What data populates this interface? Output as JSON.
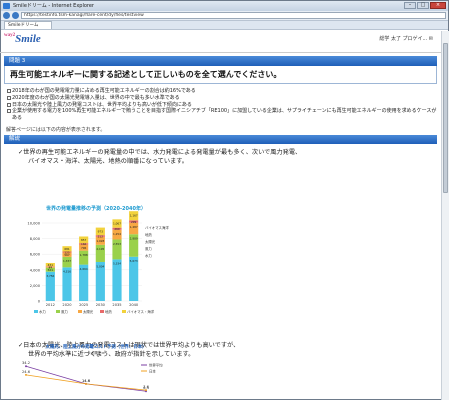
{
  "window": {
    "title": "Smileドリーム - Internet Explorer",
    "url": "https://testinfo.tsm-kanagi/flare-cent/dy/fles/testview",
    "tab": "Smileドリーム"
  },
  "header": {
    "logo": "Smile",
    "logo_prefix": "way2",
    "user": "総学 太了 プロゲイ... ✉"
  },
  "question": {
    "number_label": "問題 3",
    "title": "再生可能エネルギーに関する記述として正しいものを全て選んでください。",
    "choices": [
      "2018年のわが国の発電電力量に占める再生可能エネルギーの割合は約16%である",
      "2020年度のわが国の太陽光発電導入量は、世界の中で最も多い水準である",
      "日本の太陽光や陸上風力の発電コストは、世界平均よりも高いが低下傾向にある",
      "企業が使用する電力を100%再生可能エネルギーで賄うことを目指す国際イニシアチブ「RE100」に加盟している企業は、サプライチェーンにも再生可能エネルギーの使用を求めるケースがある"
    ],
    "answer_note": "解答ページには以下の内容が表示されます。"
  },
  "explanation": {
    "bar_label": "解説",
    "para1_line1": "✓世界の再生可能エネルギーの発電量の中では、水力発電による発電量が最も多く、次いで風力発電、",
    "para1_line2": "バイオマス・海洋、太陽光、地熱の順番になっています。",
    "para2_line1": "✓日本の太陽光、陸上風力の発電コストは現状では世界平均よりも高いですが、",
    "para2_line2": "世界の平均水準に近づくよう、政府が指針を示しています。"
  },
  "chart_data": [
    {
      "type": "bar",
      "title": "世界の発電量推移の予測（2020-2040年）",
      "categories": [
        "2012",
        "2020",
        "2025",
        "2030",
        "2035",
        "2040"
      ],
      "ylim": [
        0,
        10000
      ],
      "yticks": [
        "0",
        "2,000",
        "4,000",
        "6,000",
        "8,000",
        "10,000"
      ],
      "series": [
        {
          "name": "水力",
          "color": "#4cc6e8",
          "values": [
            3756,
            4316,
            4664,
            5004,
            5334,
            5673
          ]
        },
        {
          "name": "風力",
          "color": "#9ad14b",
          "values": [
            521,
            1337,
            1788,
            2195,
            2553,
            2889
          ]
        },
        {
          "name": "太陽光",
          "color": "#f7a844",
          "values": [
            97,
            567,
            796,
            1028,
            1254,
            1487
          ]
        },
        {
          "name": "地熱",
          "color": "#e86a6a",
          "values": [
            70,
            125,
            166,
            212,
            260,
            299
          ]
        },
        {
          "name": "バイオマス・海洋",
          "color": "#f2d23c",
          "values": [
            431,
            681,
            857,
            973,
            1067,
            1167
          ]
        }
      ],
      "legend": "bottom",
      "side_labels": [
        "バイオマス海洋",
        "地熱",
        "太陽光",
        "風力",
        "水力"
      ]
    },
    {
      "type": "line",
      "title": "太陽光、陸上風力の発電コスト予測（世界、日本）",
      "subtitle": "<太陽光>",
      "series": [
        {
          "name": "世界平均",
          "values": [
            34.2,
            14.6,
            6.4
          ]
        },
        {
          "name": "日本",
          "values": [
            24.6,
            14.6,
            7.6
          ]
        }
      ]
    }
  ]
}
